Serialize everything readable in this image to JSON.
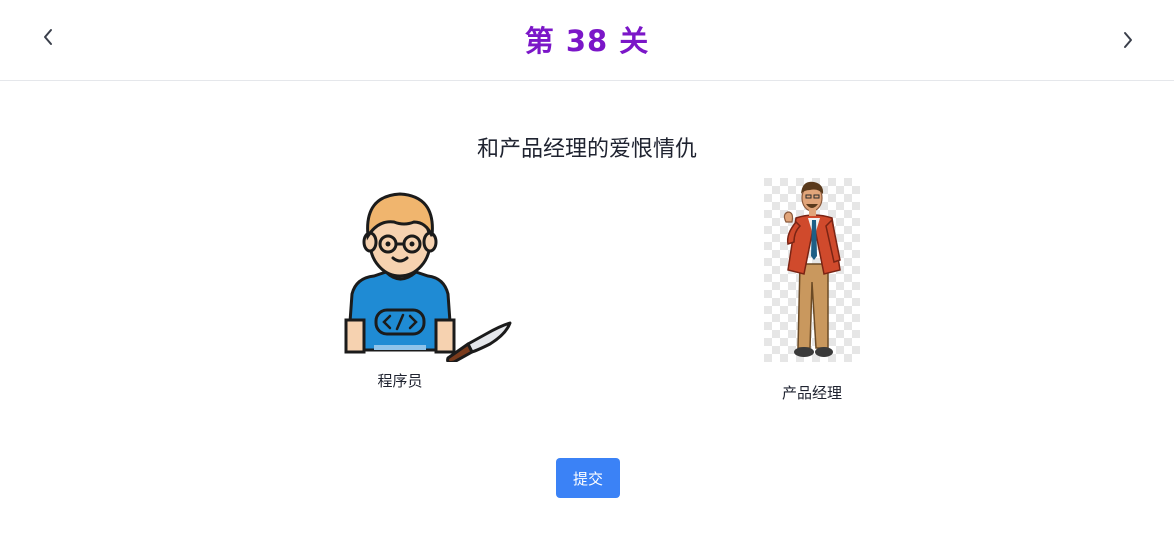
{
  "header": {
    "prev_icon": "chevron-left-icon",
    "next_icon": "chevron-right-icon",
    "level_title": "第 38 关"
  },
  "puzzle": {
    "title": "和产品经理的爱恨情仇"
  },
  "characters": [
    {
      "label": "程序员",
      "image": "programmer-with-knife"
    },
    {
      "label": "产品经理",
      "image": "product-manager-man"
    }
  ],
  "actions": {
    "submit_label": "提交"
  },
  "colors": {
    "title_purple": "#7b16c8",
    "button_blue": "#3b82f6",
    "shirt_blue": "#1f8bd4",
    "hair_orange": "#f0b56e"
  }
}
